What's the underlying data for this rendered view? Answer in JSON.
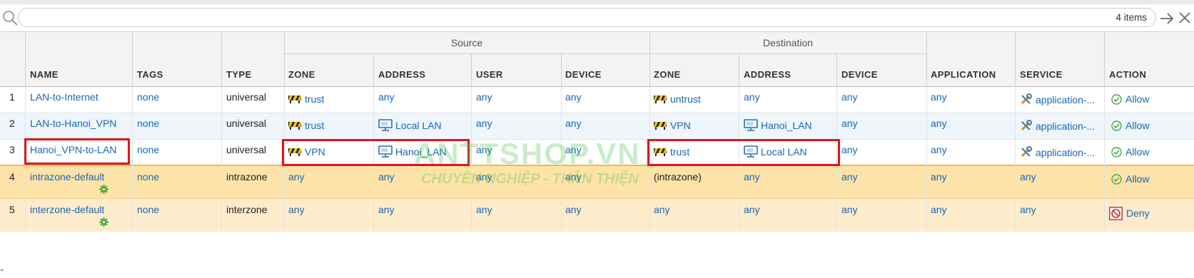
{
  "search": {
    "placeholder": "",
    "count": "4 items"
  },
  "table": {
    "groups": {
      "source": "Source",
      "destination": "Destination"
    },
    "columns": {
      "name": "NAME",
      "tags": "TAGS",
      "type": "TYPE",
      "src_zone": "ZONE",
      "src_address": "ADDRESS",
      "src_user": "USER",
      "src_device": "DEVICE",
      "dst_zone": "ZONE",
      "dst_address": "ADDRESS",
      "dst_device": "DEVICE",
      "application": "APPLICATION",
      "service": "SERVICE",
      "action": "ACTION"
    },
    "rows": [
      {
        "num": "1",
        "name": "LAN-to-Internet",
        "tags": "none",
        "type": "universal",
        "src_zone": "trust",
        "src_address": "any",
        "src_user": "any",
        "src_device": "any",
        "dst_zone": "untrust",
        "dst_address": "any",
        "dst_device": "any",
        "application": "any",
        "service": "application-...",
        "action": "Allow"
      },
      {
        "num": "2",
        "name": "LAN-to-Hanoi_VPN",
        "tags": "none",
        "type": "universal",
        "src_zone": "trust",
        "src_address": "Local LAN",
        "src_user": "any",
        "src_device": "any",
        "dst_zone": "VPN",
        "dst_address": "Hanoi_LAN",
        "dst_device": "any",
        "application": "any",
        "service": "application-...",
        "action": "Allow"
      },
      {
        "num": "3",
        "name": "Hanoi_VPN-to-LAN",
        "tags": "none",
        "type": "universal",
        "src_zone": "VPN",
        "src_address": "Hanoi_LAN",
        "src_user": "any",
        "src_device": "any",
        "dst_zone": "trust",
        "dst_address": "Local LAN",
        "dst_device": "any",
        "application": "any",
        "service": "application-...",
        "action": "Allow"
      },
      {
        "num": "4",
        "name": "intrazone-default",
        "tags": "none",
        "type": "intrazone",
        "src_zone": "any",
        "src_address": "any",
        "src_user": "any",
        "src_device": "any",
        "dst_zone": "(intrazone)",
        "dst_address": "any",
        "dst_device": "any",
        "application": "any",
        "service": "any",
        "action": "Allow"
      },
      {
        "num": "5",
        "name": "interzone-default",
        "tags": "none",
        "type": "interzone",
        "src_zone": "any",
        "src_address": "any",
        "src_user": "any",
        "src_device": "any",
        "dst_zone": "any",
        "dst_address": "any",
        "dst_device": "any",
        "application": "any",
        "service": "any",
        "action": "Deny"
      }
    ]
  },
  "watermark": {
    "line1": "ANTTSHOP.VN",
    "line2": "CHUYÊN NGHIỆP - THÂN THIỆN"
  },
  "colors": {
    "link": "#1a66b4",
    "highlight": "#e0141e",
    "row_default": "#fde3a8",
    "row_alt": "#eef6fb"
  }
}
